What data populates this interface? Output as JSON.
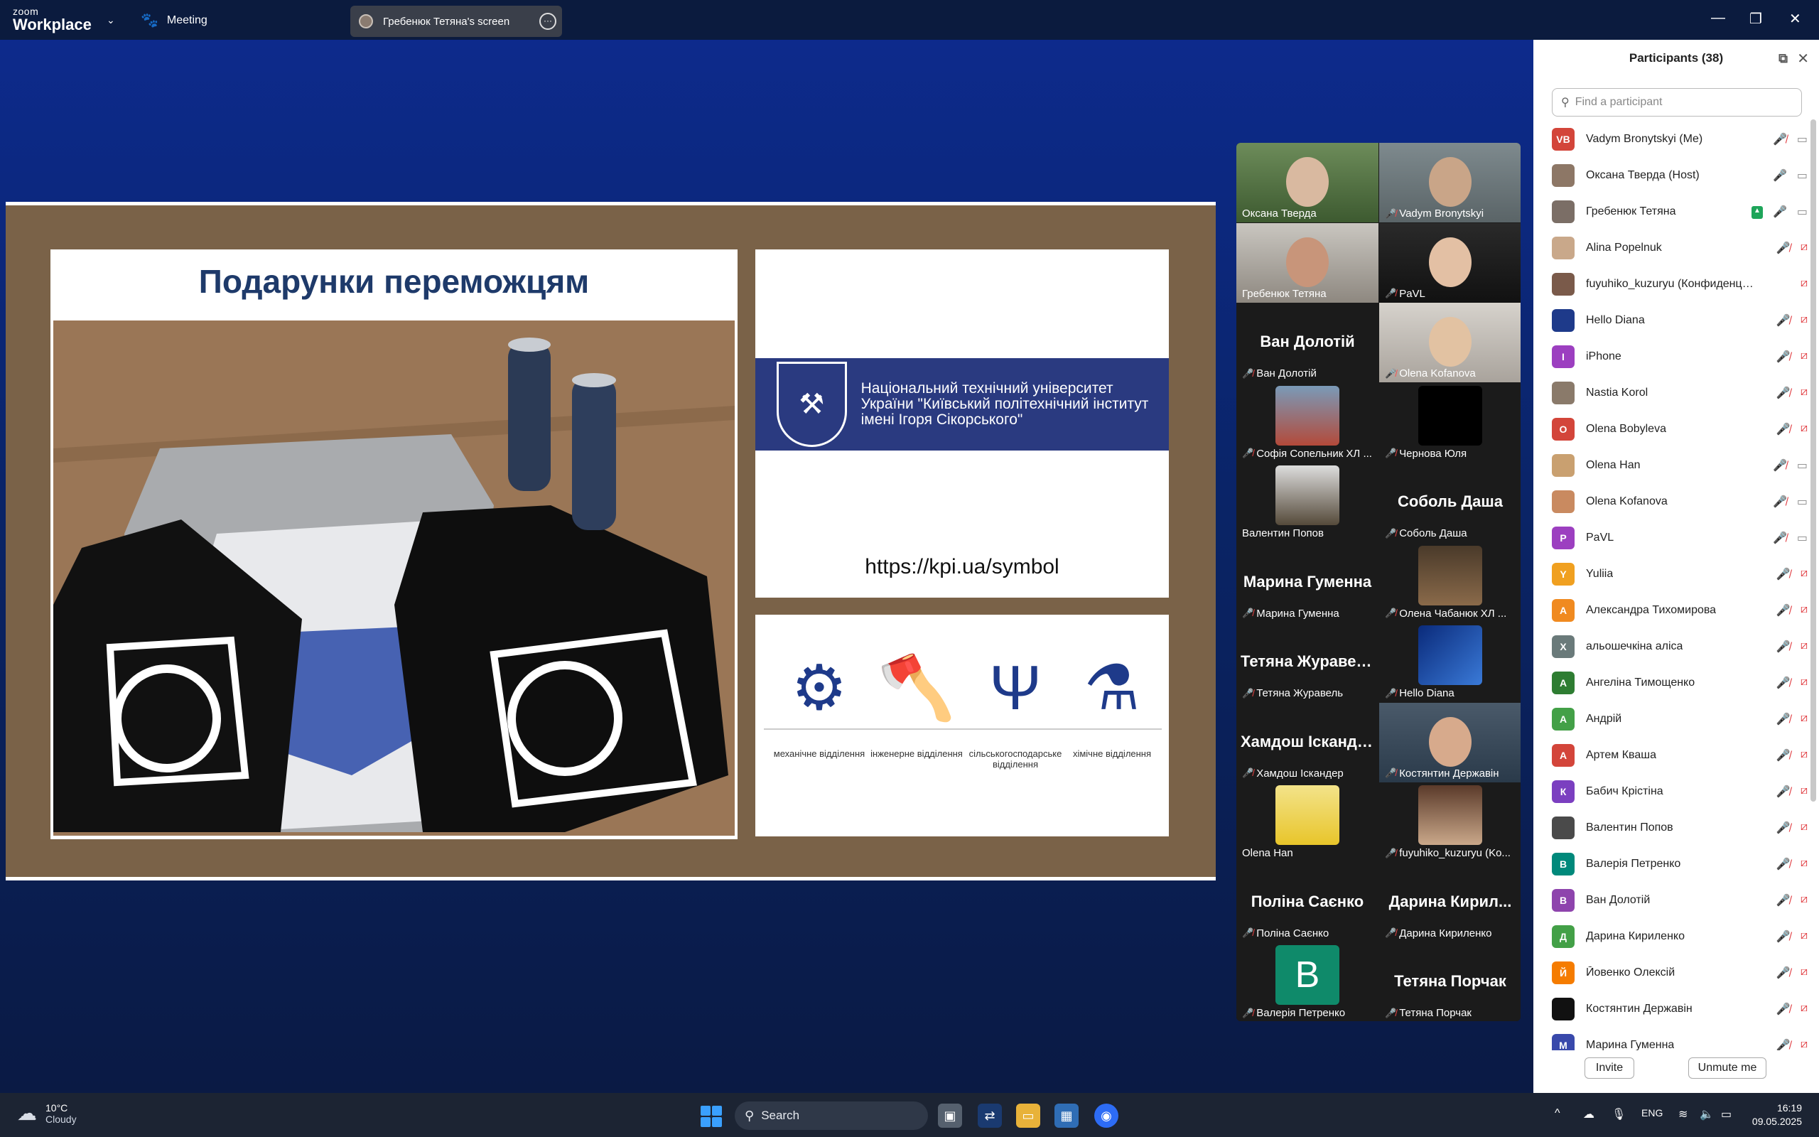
{
  "titlebar": {
    "logo_small": "zoom",
    "logo_big": "Workplace",
    "meeting_label": "Meeting",
    "share_label": "Гребенюк Тетяна's screen"
  },
  "slide": {
    "title": "Подарунки переможцям",
    "kpi_text": "Національний технічний університет України \"Київський політехнічний інститут імені Ігоря Сікорського\"",
    "url": "https://kpi.ua/symbol",
    "symbols": [
      {
        "label": "механічне відділення"
      },
      {
        "label": "інженерне відділення"
      },
      {
        "label": "сільськогосподарське відділення"
      },
      {
        "label": "хімічне відділення"
      }
    ]
  },
  "gallery": {
    "tiles": [
      {
        "name": "Оксана Тверда",
        "muted": false
      },
      {
        "name": "Vadym Bronytskyi",
        "muted": true
      },
      {
        "name": "Гребенюк Тетяна",
        "muted": false
      },
      {
        "name": "PaVL",
        "muted": true
      },
      {
        "name": "Ван Долотій",
        "big": "Ван Долотій",
        "muted": true
      },
      {
        "name": "Olena Kofanova",
        "muted": true
      },
      {
        "name": "Софія Сопельник ХЛ ...",
        "muted": true
      },
      {
        "name": "Чернова Юля",
        "muted": true
      },
      {
        "name": "Валентин Попов",
        "muted": false
      },
      {
        "name": "Соболь Даша",
        "big": "Соболь Даша",
        "muted": true
      },
      {
        "name": "Марина Гуменна",
        "big": "Марина Гуменна",
        "muted": true
      },
      {
        "name": "Олена Чабанюк ХЛ ...",
        "muted": true
      },
      {
        "name": "Тетяна Журавель",
        "big": "Тетяна Журавель",
        "muted": true
      },
      {
        "name": "Hello Diana",
        "muted": true
      },
      {
        "name": "Хамдош Іскандер",
        "big": "Хамдош Іскандер",
        "muted": true
      },
      {
        "name": "Костянтин Державін",
        "muted": true
      },
      {
        "name": "Olena Han",
        "muted": false
      },
      {
        "name": "fuyuhiko_kuzuryu (Ko...",
        "muted": true
      },
      {
        "name": "Поліна Саєнко",
        "big": "Поліна Саєнко",
        "muted": true
      },
      {
        "name": "Дарина Кириленко",
        "big": "Дарина Кирил...",
        "muted": true
      },
      {
        "name": "Валерія Петренко",
        "big": "B",
        "muted": true
      },
      {
        "name": "Тетяна Порчак",
        "big": "Тетяна Порчак",
        "muted": true
      }
    ]
  },
  "participants": {
    "title": "Participants (38)",
    "search_placeholder": "Find a participant",
    "invite_label": "Invite",
    "unmute_label": "Unmute me",
    "list": [
      {
        "name": "Vadym Bronytskyi (Me)",
        "avatar": "VB",
        "color": "#d3453a",
        "mic": "muted",
        "cam": "on"
      },
      {
        "name": "Оксана Тверда (Host)",
        "avatar": "",
        "color": "#8d7766",
        "mic": "on",
        "cam": "on"
      },
      {
        "name": "Гребенюк Тетяна",
        "avatar": "",
        "color": "#7b6e66",
        "mic": "on",
        "cam": "on",
        "sharing": true
      },
      {
        "name": "Alina Popelnuk",
        "avatar": "",
        "color": "#c9a88a",
        "mic": "muted",
        "cam": "off"
      },
      {
        "name": "fuyuhiko_kuzuryu (Конфиденциальн...",
        "avatar": "",
        "color": "#7a5a4a",
        "mic": "",
        "cam": "off"
      },
      {
        "name": "Hello Diana",
        "avatar": "",
        "color": "#1e3a8a",
        "mic": "muted",
        "cam": "off"
      },
      {
        "name": "iPhone",
        "avatar": "I",
        "color": "#9c3fc0",
        "mic": "muted",
        "cam": "off"
      },
      {
        "name": "Nastia Korol",
        "avatar": "",
        "color": "#8a7a6a",
        "mic": "muted",
        "cam": "off"
      },
      {
        "name": "Olena Bobyleva",
        "avatar": "O",
        "color": "#d3453a",
        "mic": "muted",
        "cam": "off"
      },
      {
        "name": "Olena Han",
        "avatar": "",
        "color": "#c9a070",
        "mic": "muted",
        "cam": "on"
      },
      {
        "name": "Olena Kofanova",
        "avatar": "",
        "color": "#c98a60",
        "mic": "muted",
        "cam": "on"
      },
      {
        "name": "PaVL",
        "avatar": "P",
        "color": "#9c3fc0",
        "mic": "muted",
        "cam": "on"
      },
      {
        "name": "Yuliia",
        "avatar": "Y",
        "color": "#f0a020",
        "mic": "muted",
        "cam": "off"
      },
      {
        "name": "Александра Тихомирова",
        "avatar": "А",
        "color": "#f08a20",
        "mic": "muted",
        "cam": "off"
      },
      {
        "name": "альошечкіна аліса",
        "avatar": "Х",
        "color": "#6a7a7a",
        "mic": "muted",
        "cam": "off"
      },
      {
        "name": "Ангеліна Тимощенко",
        "avatar": "А",
        "color": "#2e7d32",
        "mic": "muted",
        "cam": "off"
      },
      {
        "name": "Андрій",
        "avatar": "А",
        "color": "#43a047",
        "mic": "muted",
        "cam": "off"
      },
      {
        "name": "Артем Кваша",
        "avatar": "А",
        "color": "#d3453a",
        "mic": "muted",
        "cam": "off"
      },
      {
        "name": "Бабич Крістіна",
        "avatar": "К",
        "color": "#7b3fc0",
        "mic": "muted",
        "cam": "off"
      },
      {
        "name": "Валентин Попов",
        "avatar": "",
        "color": "#4a4a4a",
        "mic": "muted",
        "cam": "off"
      },
      {
        "name": "Валерія Петренко",
        "avatar": "В",
        "color": "#00897b",
        "mic": "muted",
        "cam": "off"
      },
      {
        "name": "Ван Долотій",
        "avatar": "В",
        "color": "#8e44ad",
        "mic": "muted",
        "cam": "off"
      },
      {
        "name": "Дарина Кириленко",
        "avatar": "Д",
        "color": "#43a047",
        "mic": "muted",
        "cam": "off"
      },
      {
        "name": "Йовенко Олексій",
        "avatar": "Й",
        "color": "#f57c00",
        "mic": "muted",
        "cam": "off"
      },
      {
        "name": "Костянтин Державін",
        "avatar": "",
        "color": "#111111",
        "mic": "muted",
        "cam": "off"
      },
      {
        "name": "Марина Гуменна",
        "avatar": "М",
        "color": "#3949ab",
        "mic": "muted",
        "cam": "off"
      }
    ]
  },
  "taskbar": {
    "temp": "10°C",
    "weather": "Cloudy",
    "search_label": "Search",
    "lang": "ENG",
    "time": "16:19",
    "date": "09.05.2025"
  }
}
